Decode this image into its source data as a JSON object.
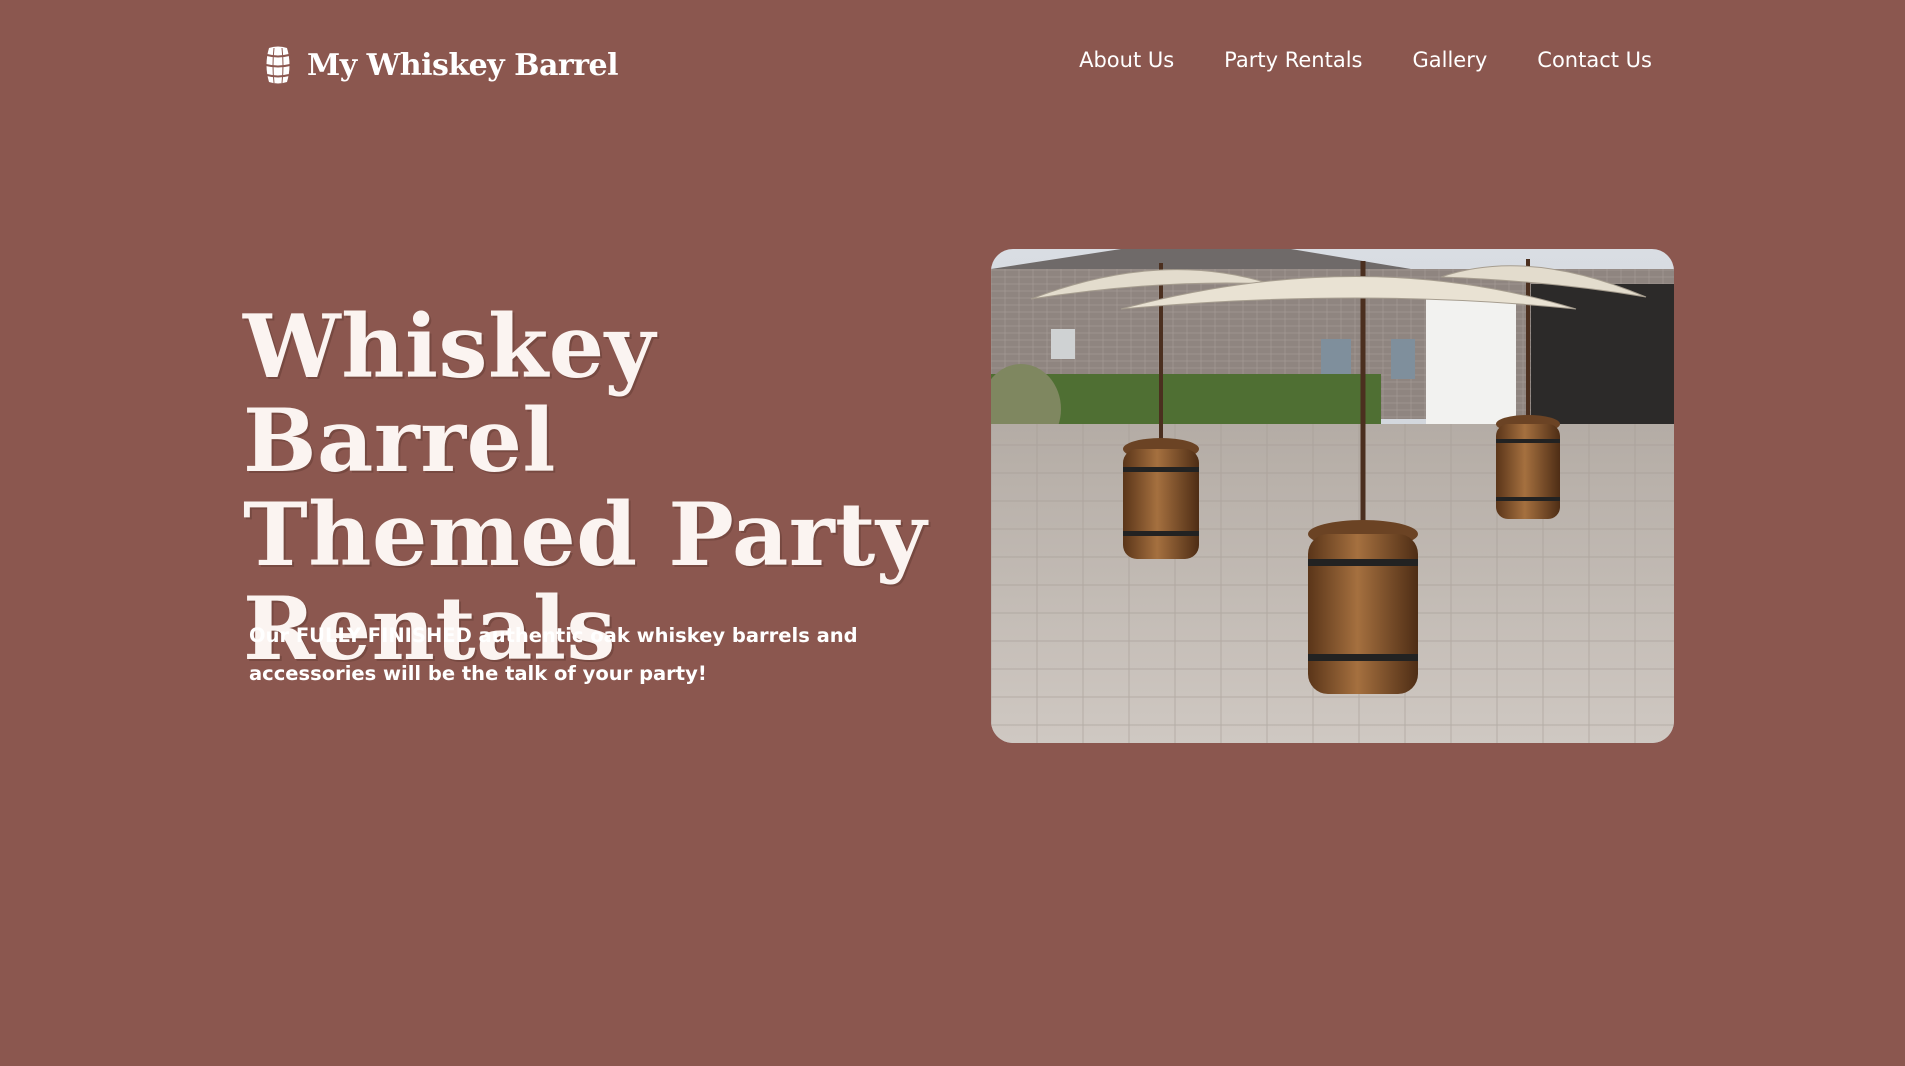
{
  "header": {
    "logo_text": "My Whiskey Barrel",
    "logo_icon": "barrel-icon",
    "nav": [
      {
        "label": "About Us"
      },
      {
        "label": "Party Rentals"
      },
      {
        "label": "Gallery"
      },
      {
        "label": "Contact Us"
      }
    ]
  },
  "hero": {
    "title": "Whiskey Barrel Themed Party Rentals",
    "subtitle": "Our FULLY FINISHED authentic oak whiskey barrels and accessories will be the talk of your party!"
  },
  "colors": {
    "background": "#8b574f",
    "text": "#ffffff"
  }
}
